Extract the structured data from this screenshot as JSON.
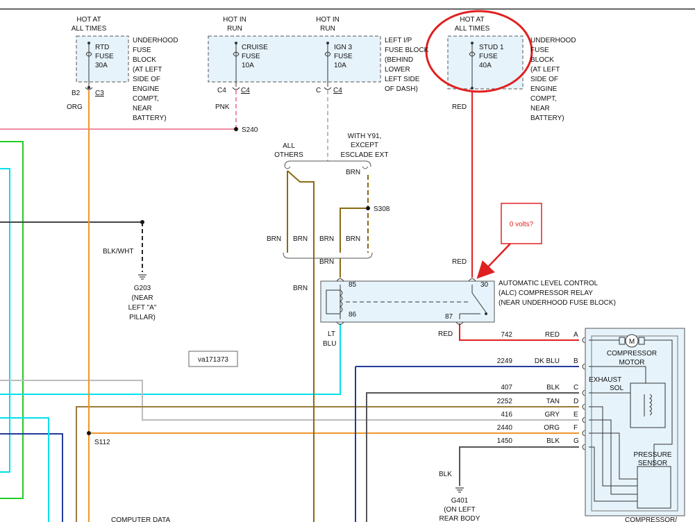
{
  "diagram_id": "va171373",
  "callout_text": "0 volts?",
  "fuses": {
    "rtd": {
      "supply": [
        "HOT AT",
        "ALL TIMES"
      ],
      "name": "RTD",
      "word": "FUSE",
      "rating": "30A",
      "pin_left": "B2",
      "pin_right": "C3",
      "wire_color": "ORG",
      "location": [
        "UNDERHOOD",
        "FUSE",
        "BLOCK",
        "(AT LEFT",
        "SIDE OF",
        "ENGINE",
        "COMPT,",
        "NEAR",
        "BATTERY)"
      ]
    },
    "cruise": {
      "supply": [
        "HOT IN",
        "RUN"
      ],
      "name": "CRUISE",
      "word": "FUSE",
      "rating": "10A",
      "pin_left": "C4",
      "pin_right": "C4",
      "wire_color": "PNK"
    },
    "ign3": {
      "supply": [
        "HOT IN",
        "RUN"
      ],
      "name": "IGN 3",
      "word": "FUSE",
      "rating": "10A",
      "pin_left": "C",
      "pin_right": "C4"
    },
    "ip_location": [
      "LEFT I/P",
      "FUSE BLOCK",
      "(BEHIND",
      "LOWER",
      "LEFT SIDE",
      "OF DASH)"
    ],
    "stud1": {
      "supply": [
        "HOT AT",
        "ALL TIMES"
      ],
      "name": "STUD 1",
      "word": "FUSE",
      "rating": "40A",
      "wire_color": "RED",
      "location": [
        "UNDERHOOD",
        "FUSE",
        "BLOCK",
        "(AT LEFT",
        "SIDE OF",
        "ENGINE",
        "COMPT,",
        "NEAR",
        "BATTERY)"
      ]
    }
  },
  "splices": {
    "s240": "S240",
    "s308": "S308",
    "s112": "S112"
  },
  "grounds": {
    "g203": {
      "wire": "BLK/WHT",
      "lines": [
        "G203",
        "(NEAR",
        "LEFT \"A\"",
        "PILLAR)"
      ]
    },
    "g401": {
      "wire": "BLK",
      "lines": [
        "G401",
        "(ON LEFT",
        "REAR BODY"
      ]
    }
  },
  "variants": {
    "others": [
      "ALL",
      "OTHERS"
    ],
    "y91": [
      "WITH Y91,",
      "EXCEPT",
      "ESCLADE EXT"
    ]
  },
  "wire_labels": {
    "brn": "BRN",
    "red": "RED",
    "lt": "LT",
    "blu": "BLU"
  },
  "relay": {
    "title": [
      "AUTOMATIC LEVEL CONTROL",
      "(ALC) COMPRESSOR RELAY",
      "(NEAR UNDERHOOD FUSE BLOCK)"
    ],
    "pins": {
      "p85": "85",
      "p86": "86",
      "p30": "30",
      "p87": "87"
    }
  },
  "connector": [
    {
      "circuit": "742",
      "color": "RED",
      "pin": "A"
    },
    {
      "circuit": "2249",
      "color": "DK BLU",
      "pin": "B"
    },
    {
      "circuit": "407",
      "color": "BLK",
      "pin": "C"
    },
    {
      "circuit": "2252",
      "color": "TAN",
      "pin": "D"
    },
    {
      "circuit": "416",
      "color": "GRY",
      "pin": "E"
    },
    {
      "circuit": "2440",
      "color": "ORG",
      "pin": "F"
    },
    {
      "circuit": "1450",
      "color": "BLK",
      "pin": "G"
    }
  ],
  "compressor": {
    "motor_symbol": "M",
    "motor": [
      "COMPRESSOR",
      "MOTOR"
    ],
    "exhaust": [
      "EXHAUST",
      "SOL"
    ],
    "pressure": [
      "PRESSURE",
      "SENSOR"
    ],
    "assembly": [
      "COMPRESSOR/"
    ]
  },
  "bottom_text": "COMPUTER DATA"
}
